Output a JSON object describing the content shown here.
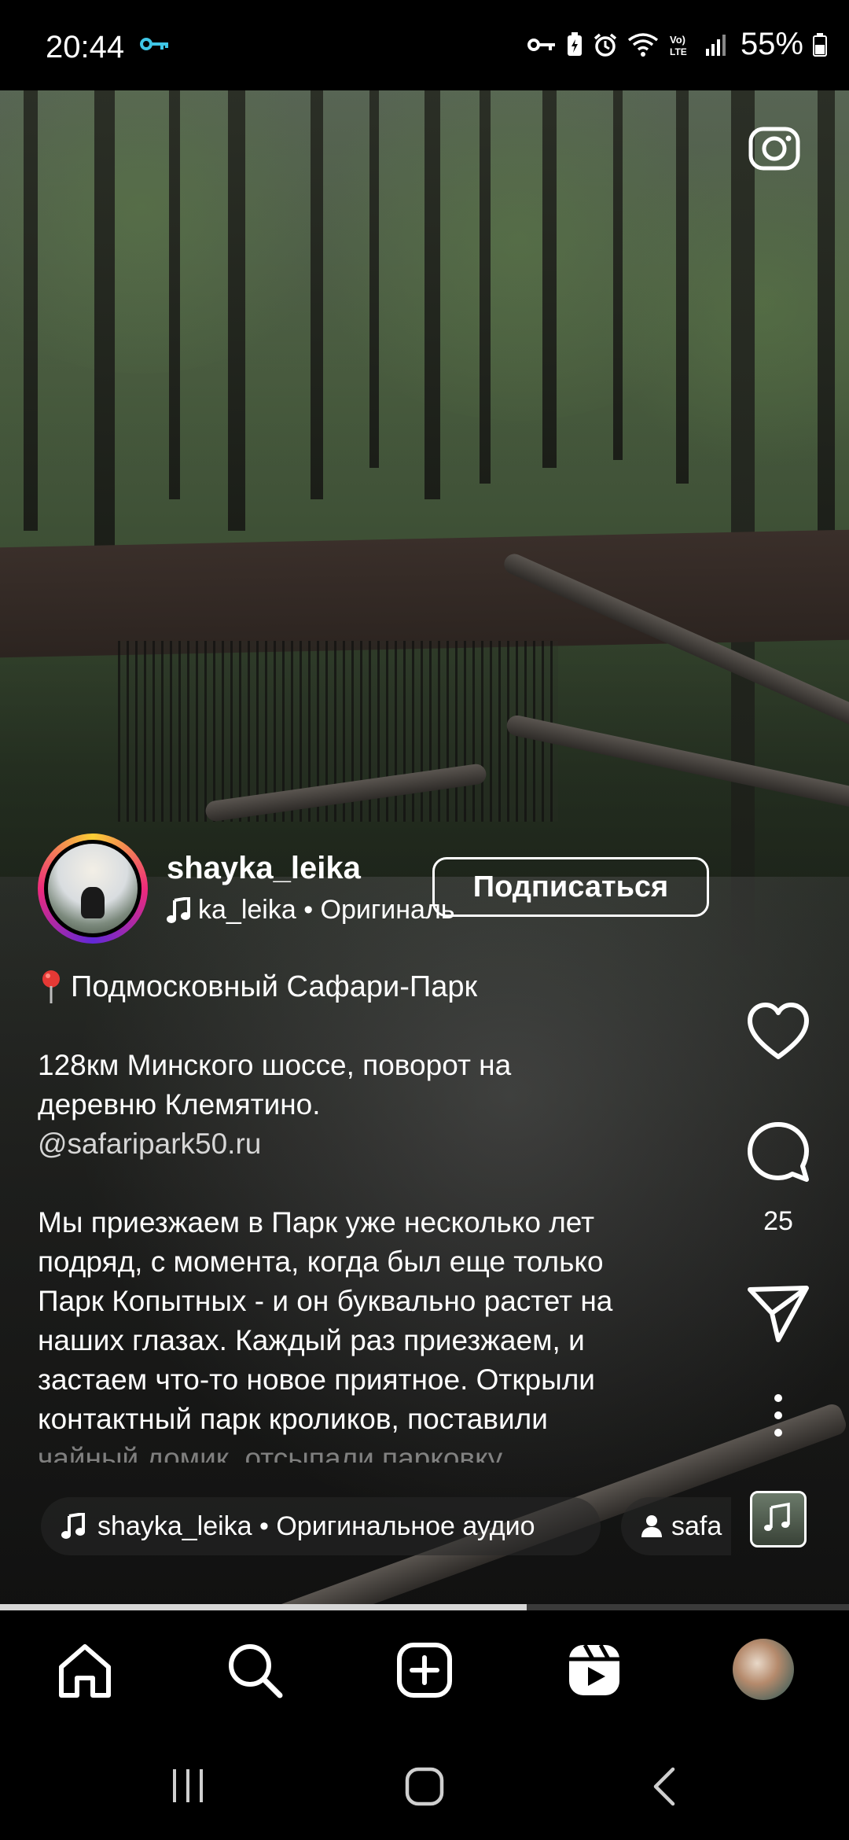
{
  "status_bar": {
    "time": "20:44",
    "battery": "55%",
    "icons": [
      "key-icon",
      "vpn-key-icon",
      "battery-saver-icon",
      "alarm-icon",
      "wifi-icon",
      "volte-icon",
      "signal-icon",
      "battery-icon"
    ]
  },
  "post": {
    "username": "shayka_leika",
    "audio_credit": "ka_leika • Оригиналь",
    "follow_label": "Подписаться",
    "location": "Подмосковный Сафари-Парк",
    "caption_lines_1": [
      "128км Минского шоссе, поворот на",
      "деревню Клемятино."
    ],
    "caption_link": "@safaripark50.ru",
    "caption_lines_2": [
      "Мы приезжаем в Парк уже несколько лет",
      "подряд, с момента, когда был еще только",
      "Парк Копытных - и он буквально растет на",
      "наших глазах. Каждый раз приезжаем, и",
      "застаем что-то новое приятное. Открыли",
      "контактный парк кроликов, поставили"
    ],
    "caption_fade": "чайный домик, отсыпали парковку",
    "audio_pill": "shayka_leika • Оригинальное аудио",
    "people_pill": "safa"
  },
  "actions": {
    "comment_count": "25"
  },
  "progress": {
    "fraction": 0.62
  },
  "nav": {
    "items": [
      "home-icon",
      "search-icon",
      "create-icon",
      "reels-icon",
      "profile-avatar"
    ]
  }
}
